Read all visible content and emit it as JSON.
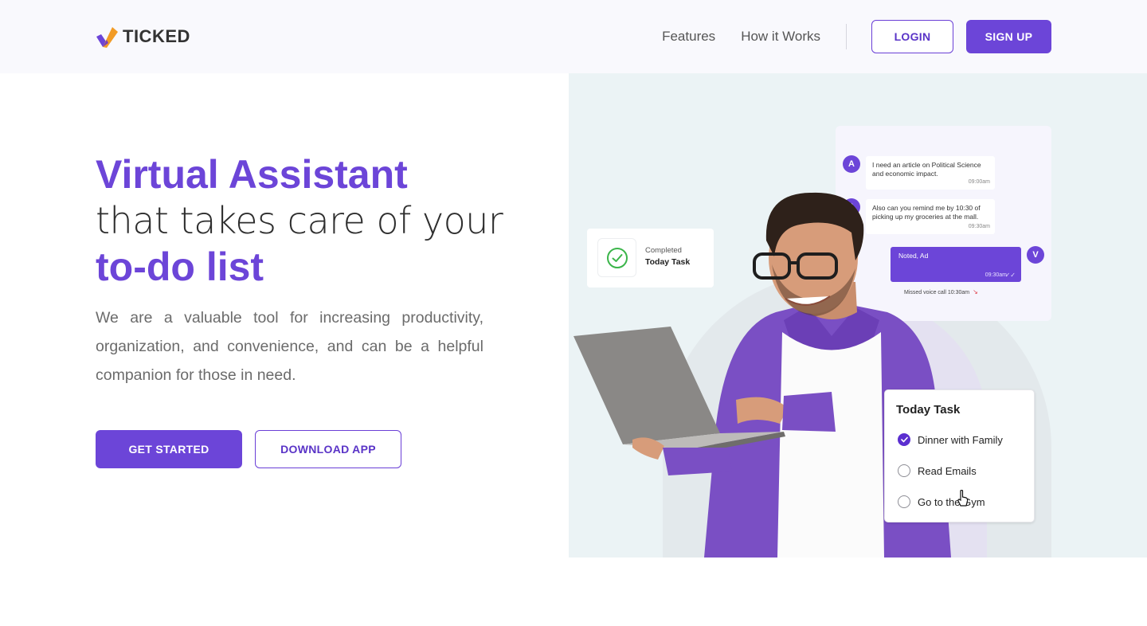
{
  "brand": {
    "name": "TICKED",
    "accent": "#6c45d8",
    "logo_colors": [
      "#6c45d8",
      "#f29b26"
    ]
  },
  "nav": {
    "links": [
      "Features",
      "How it Works"
    ],
    "login_label": "LOGIN",
    "signup_label": "SIGN UP"
  },
  "hero": {
    "title_line1": "Virtual Assistant",
    "title_line2": "that takes care of your",
    "title_line3": "to-do list",
    "description": "We are a valuable tool for increasing productivity, organization, and convenience, and can be a helpful companion for those in need.",
    "cta_primary": "GET STARTED",
    "cta_secondary": "DOWNLOAD APP"
  },
  "chat": {
    "messages": [
      {
        "avatar": "A",
        "text": "I need an article on Political Science and economic impact.",
        "time": "09:00am"
      },
      {
        "avatar": "A",
        "text": "Also can you remind me by 10:30 of picking  up my groceries at the mall.",
        "time": "09:30am"
      }
    ],
    "reply": {
      "avatar": "V",
      "text": "Noted, Ad",
      "time": "09:30am"
    },
    "missed_call": "Missed voice call  10:30am"
  },
  "completed_card": {
    "label": "Completed",
    "title": "Today Task"
  },
  "today_task": {
    "title": "Today Task",
    "items": [
      {
        "label": "Dinner with Family",
        "done": true
      },
      {
        "label": "Read Emails",
        "done": false
      },
      {
        "label": "Go to the Gym",
        "done": false
      }
    ]
  }
}
